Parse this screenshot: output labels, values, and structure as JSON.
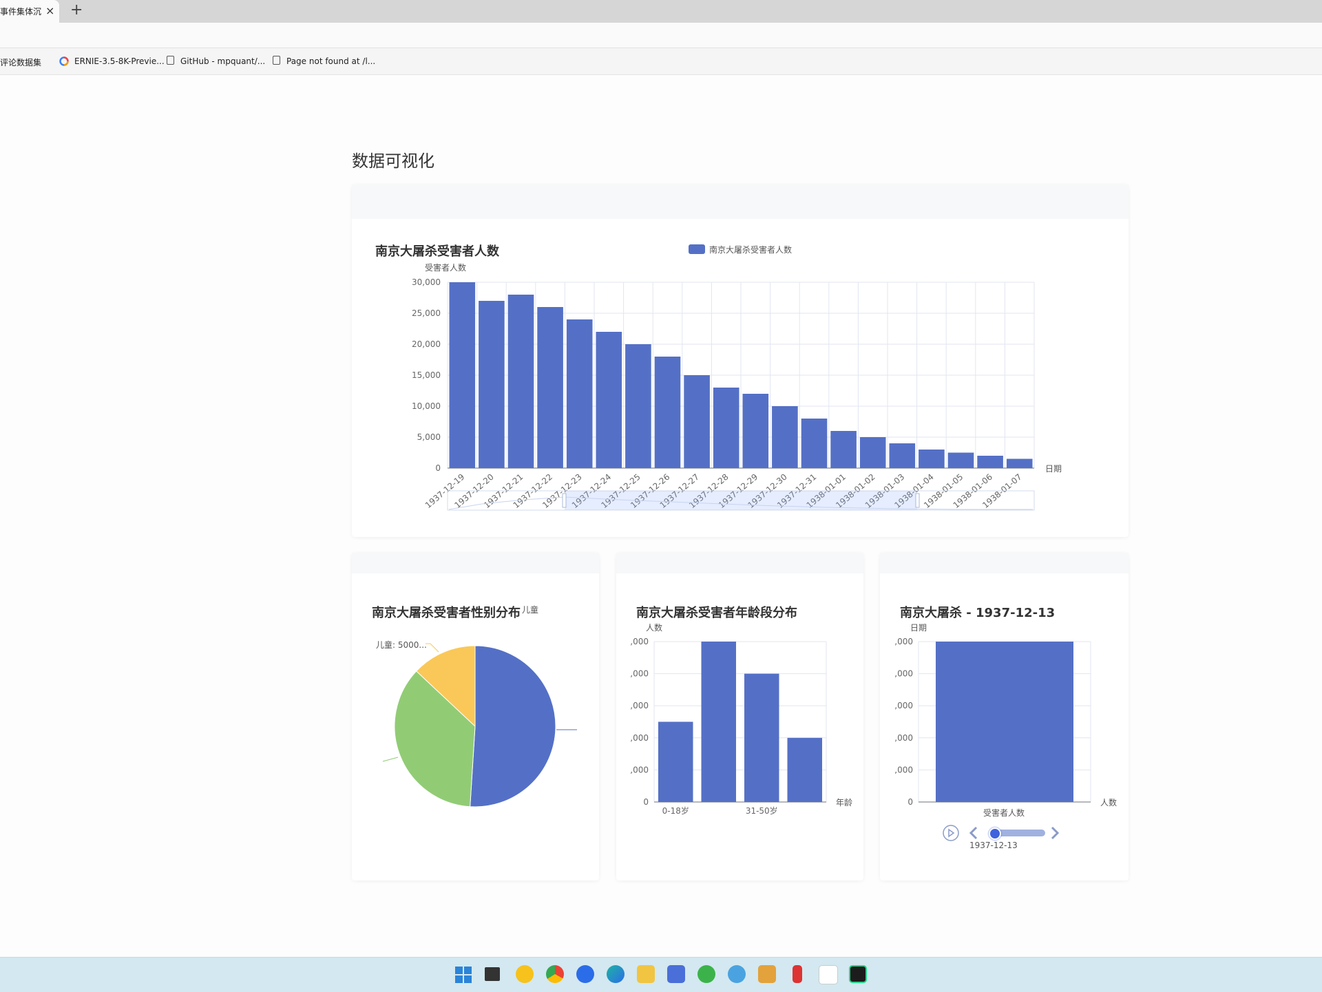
{
  "browser": {
    "tab_title": "事件集体沉",
    "tab_close": "×",
    "new_tab": "+",
    "bookmarks": [
      "评论数据集",
      "ERNIE-3.5-8K-Previe...",
      "GitHub - mpquant/...",
      "Page not found at /l..."
    ]
  },
  "page": {
    "title": "数据可视化"
  },
  "colors": {
    "blue": "#5470c6",
    "green": "#91cc75",
    "yellow": "#fac858"
  },
  "main_chart": {
    "title": "南京大屠杀受害者人数",
    "legend": "南京大屠杀受害者人数",
    "y_axis_name": "受害者人数",
    "x_axis_name": "日期"
  },
  "pie_chart": {
    "title": "南京大屠杀受害者性别分布",
    "legend_tail": "儿童",
    "label_children": "儿童: 5000..."
  },
  "age_chart": {
    "title": "南京大屠杀受害者年龄段分布",
    "y_axis_name": "人数",
    "x_axis_name": "年龄",
    "tick_labels": [
      ",000",
      ",000",
      ",000",
      ",000",
      ",000",
      "0"
    ],
    "x_labels": [
      "0-18岁",
      "31-50岁"
    ]
  },
  "timeline_chart": {
    "title": "南京大屠杀 - 1937-12-13",
    "y_axis_name": "日期",
    "x_axis_name": "人数",
    "tick_labels": [
      ",000",
      ",000",
      ",000",
      ",000",
      ",000",
      "0"
    ],
    "x_label": "受害者人数",
    "timeline_label": "1937-12-13"
  },
  "chart_data": [
    {
      "type": "bar",
      "title": "南京大屠杀受害者人数",
      "xlabel": "日期",
      "ylabel": "受害者人数",
      "ylim": [
        0,
        30000
      ],
      "yticks": [
        "0",
        "5,000",
        "10,000",
        "15,000",
        "20,000",
        "25,000",
        "30,000"
      ],
      "grid": true,
      "legend": "top-center",
      "categories": [
        "1937-12-19",
        "1937-12-20",
        "1937-12-21",
        "1937-12-22",
        "1937-12-23",
        "1937-12-24",
        "1937-12-25",
        "1937-12-26",
        "1937-12-27",
        "1937-12-28",
        "1937-12-29",
        "1937-12-30",
        "1937-12-31",
        "1938-01-01",
        "1938-01-02",
        "1938-01-03",
        "1938-01-04",
        "1938-01-05",
        "1938-01-06",
        "1938-01-07"
      ],
      "series": [
        {
          "name": "南京大屠杀受害者人数",
          "values": [
            30000,
            27000,
            28000,
            26000,
            24000,
            22000,
            20000,
            18000,
            15000,
            13000,
            12000,
            10000,
            8000,
            6000,
            5000,
            4000,
            3000,
            2500,
            2000,
            1500
          ]
        }
      ]
    },
    {
      "type": "pie",
      "title": "南京大屠杀受害者性别分布",
      "slices": [
        {
          "label": "",
          "value": 51,
          "color": "#5470c6"
        },
        {
          "label": "",
          "value": 36,
          "color": "#91cc75"
        },
        {
          "label": "儿童",
          "value": 13,
          "color": "#fac858"
        }
      ]
    },
    {
      "type": "bar",
      "title": "南京大屠杀受害者年龄段分布",
      "ylabel": "人数",
      "xlabel": "年龄",
      "categories": [
        "0-18岁",
        "",
        "31-50岁",
        ""
      ],
      "values": [
        50,
        100,
        80,
        40
      ],
      "ylim": [
        0,
        100
      ]
    },
    {
      "type": "bar",
      "title": "南京大屠杀 - 1937-12-13",
      "categories": [
        "受害者人数"
      ],
      "values": [
        100
      ],
      "ylim": [
        0,
        100
      ]
    }
  ]
}
